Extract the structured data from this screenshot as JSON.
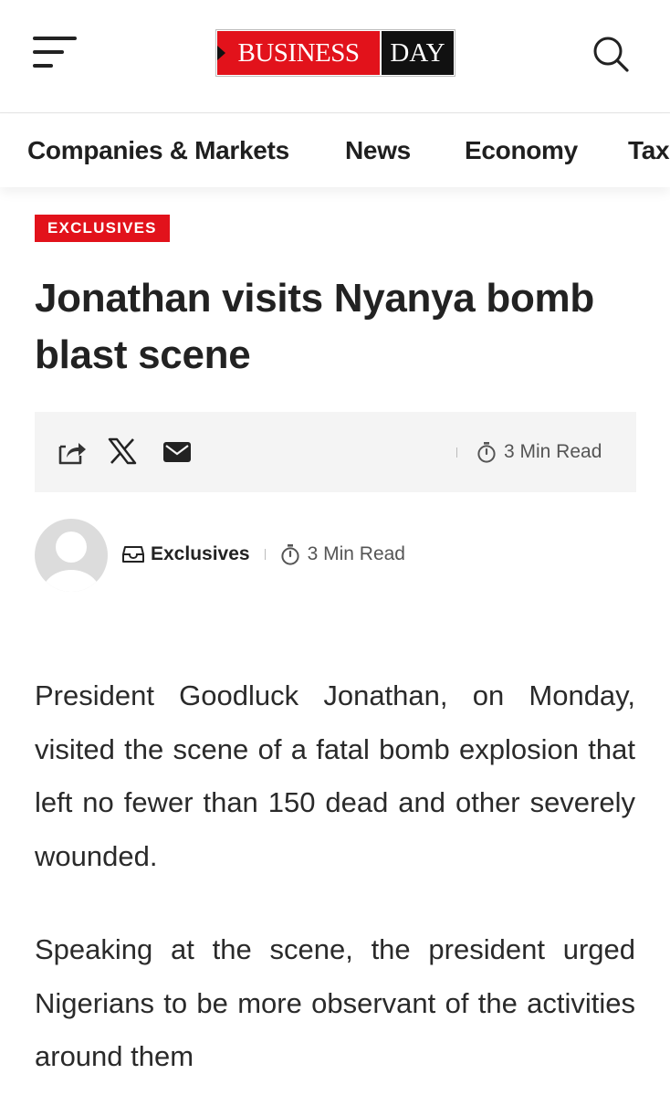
{
  "header": {
    "logo_business": "BUSINESS",
    "logo_day": "DAY",
    "menu_icon": "hamburger-menu-icon",
    "search_icon": "search-icon"
  },
  "nav": {
    "items": [
      {
        "label": "Companies & Markets"
      },
      {
        "label": "News"
      },
      {
        "label": "Economy"
      },
      {
        "label": "Tax"
      }
    ]
  },
  "article": {
    "category_badge": "EXCLUSIVES",
    "title": "Jonathan visits Nyanya bomb blast scene",
    "share": {
      "icons": [
        "share-icon",
        "x-twitter-icon",
        "email-icon"
      ],
      "read_time": "3 Min Read"
    },
    "meta": {
      "category": "Exclusives",
      "read_time": "3 Min Read"
    },
    "paragraphs": [
      "President Goodluck Jonathan, on Monday, visited the scene of a fatal bomb explosion that left no fewer than 150 dead and other severely wounded.",
      "Speaking at the scene, the president urged Nigerians to be more observant of the activities around them"
    ]
  },
  "colors": {
    "brand_red": "#e2121b",
    "logo_black": "#111111",
    "text": "#222222",
    "muted": "#555555",
    "sharebar_bg": "#f4f4f4"
  }
}
